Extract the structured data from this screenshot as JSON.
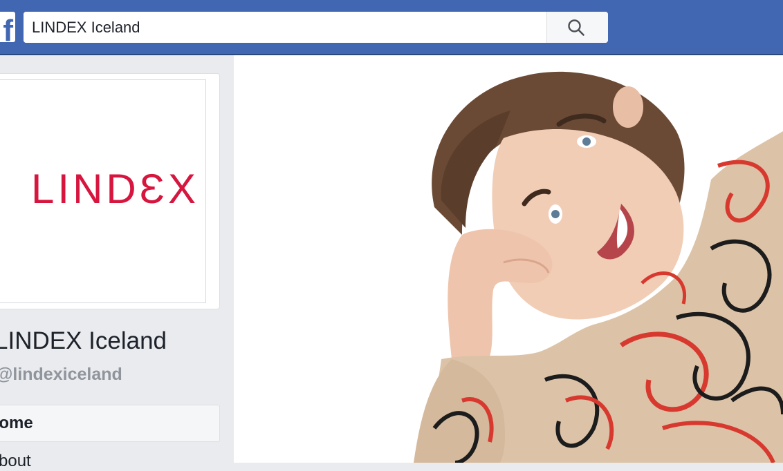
{
  "header": {
    "logo_letter": "f",
    "search": {
      "value": "LINDEX Iceland"
    },
    "search_icon": "search-icon"
  },
  "page": {
    "profile_logo_text": "LINDƐX",
    "name": "LINDEX Iceland",
    "handle": "@lindexiceland"
  },
  "nav": {
    "items": [
      {
        "label": "Home",
        "active": true
      },
      {
        "label": "About",
        "active": false
      }
    ]
  },
  "colors": {
    "brand_blue": "#4267b2",
    "lindex_red": "#d6163f",
    "background": "#e9ebee"
  },
  "cover": {
    "content": "photo-of-smiling-woman-in-patterned-sweater"
  }
}
